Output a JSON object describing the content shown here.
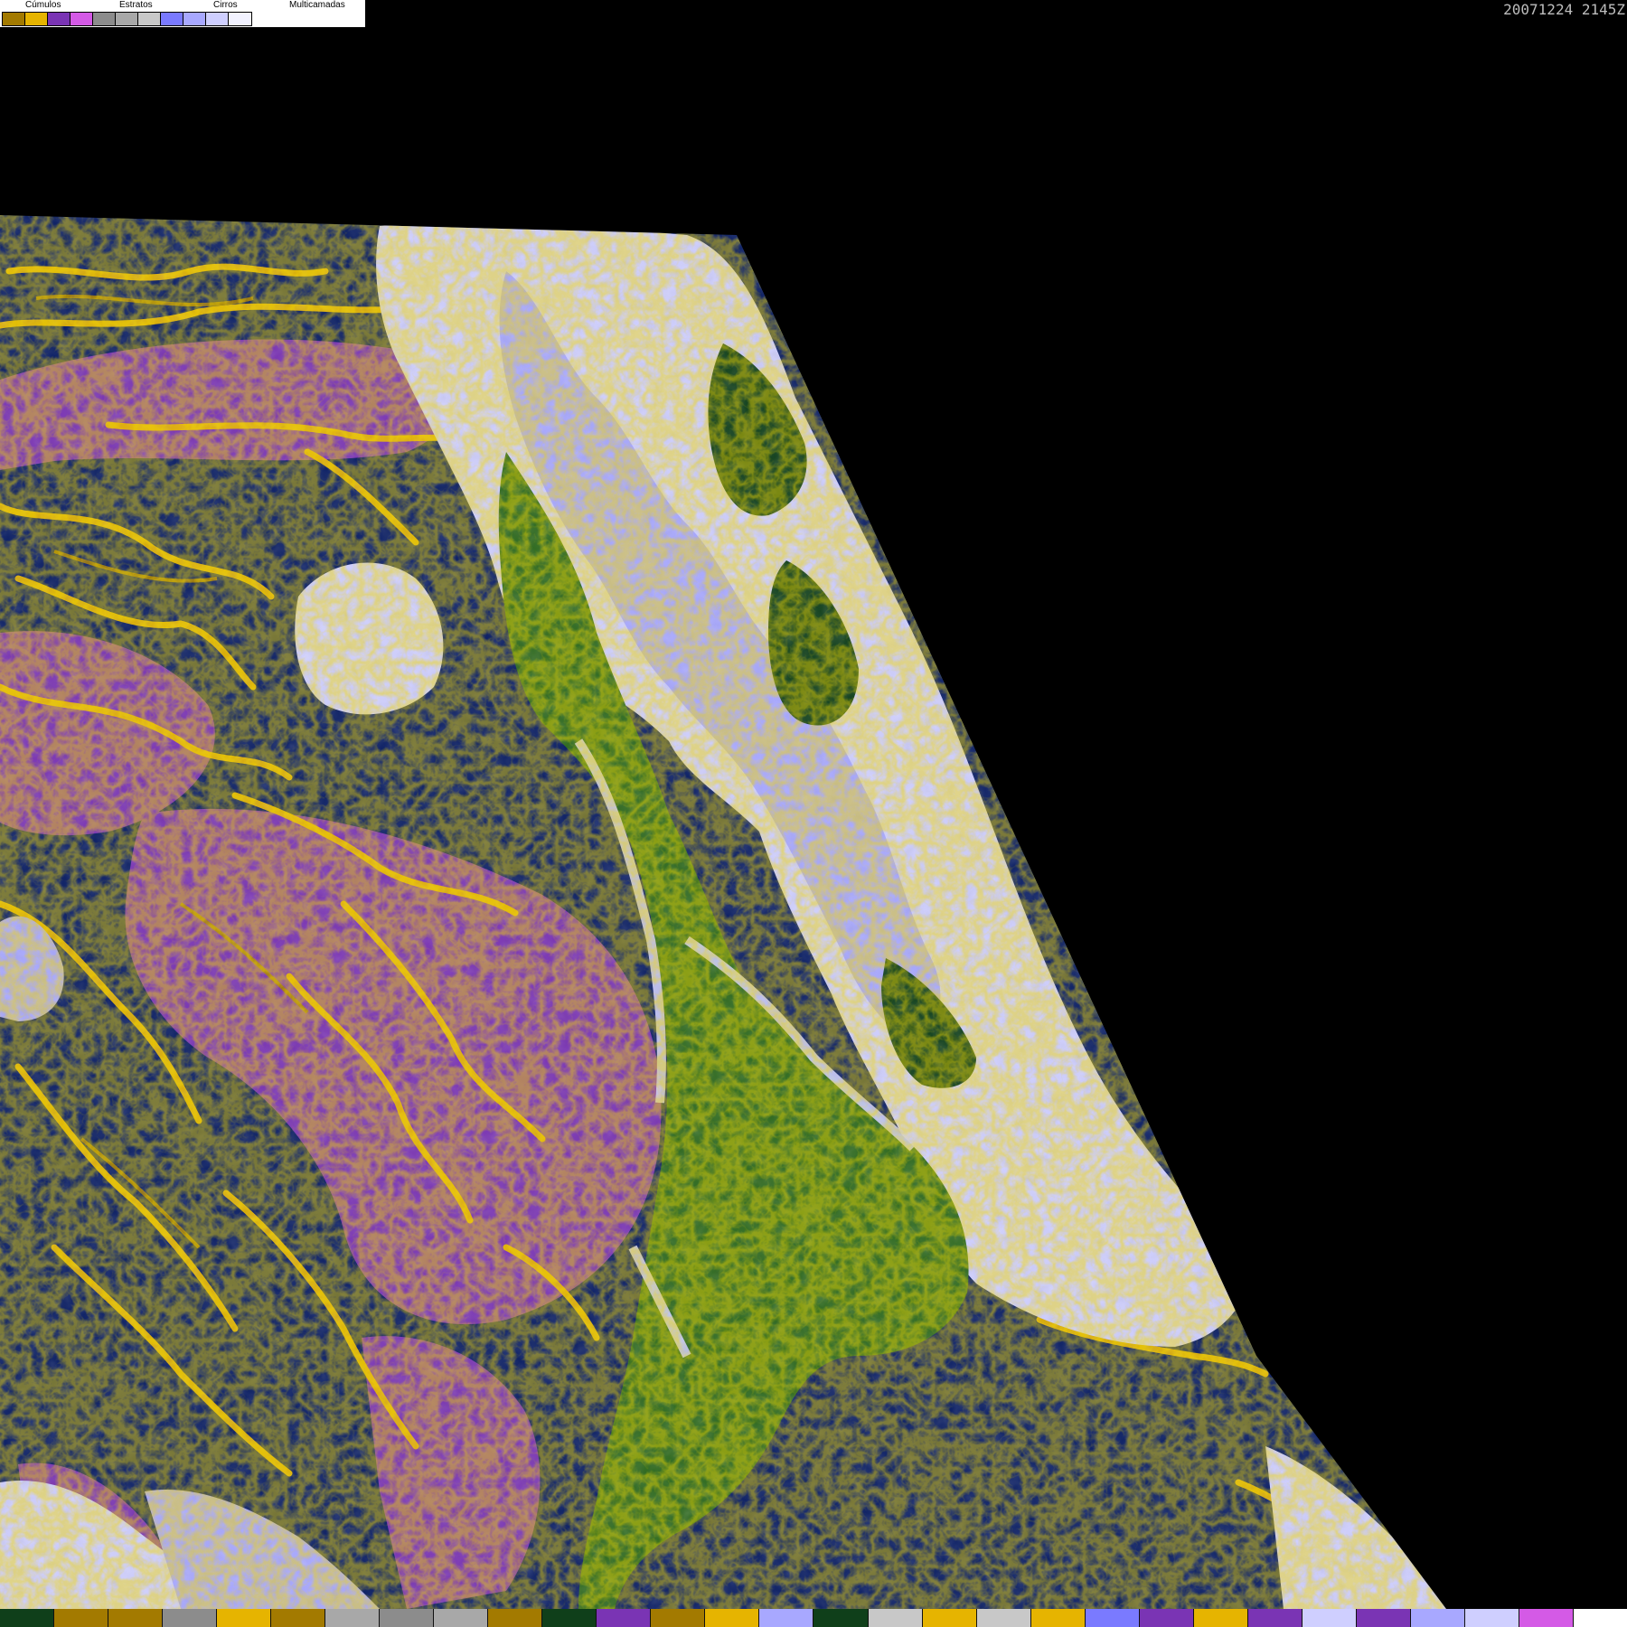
{
  "legend": {
    "groups": [
      {
        "label": "Cúmulos",
        "colors": [
          "#a37a00",
          "#e6b400"
        ]
      },
      {
        "label": "Estratos",
        "colors": [
          "#7a34b4",
          "#d45ae6"
        ]
      },
      {
        "label": "Cirros",
        "colors": [
          "#8c8c8c",
          "#a8a8a8",
          "#c8c8c8"
        ]
      },
      {
        "label": "Multicamadas",
        "colors": [
          "#7a7aff",
          "#a8a8ff",
          "#cfcfff",
          "#f2f2ff"
        ]
      }
    ]
  },
  "timestamp": "20071224 2145Z",
  "colors": {
    "background": "#000000",
    "ocean": "#0a1e64",
    "land": "#2e6a1e",
    "land_dark": "#0f3f1a",
    "cumulus_dark": "#a37a00",
    "cumulus": "#e6b400",
    "stratus": "#7a34b4",
    "stratus_light": "#d45ae6",
    "cirrus": "#a8a8a8",
    "multilayer_light": "#cfcfff",
    "multilayer": "#a8a8ff"
  },
  "bottom_strip": [
    "#0f3f1a",
    "#a37a00",
    "#a37a00",
    "#8c8c8c",
    "#e6b400",
    "#a37a00",
    "#a8a8a8",
    "#8c8c8c",
    "#a8a8a8",
    "#a37a00",
    "#0f3f1a",
    "#7a34b4",
    "#a37a00",
    "#e6b400",
    "#a8a8ff",
    "#0f3f1a",
    "#c8c8c8",
    "#e6b400",
    "#c8c8c8",
    "#e6b400",
    "#7a7aff",
    "#7a34b4",
    "#e6b400",
    "#7a34b4",
    "#cfcfff",
    "#7a34b4",
    "#a8a8ff",
    "#cfcfff",
    "#d45ae6",
    "#ffffff"
  ]
}
